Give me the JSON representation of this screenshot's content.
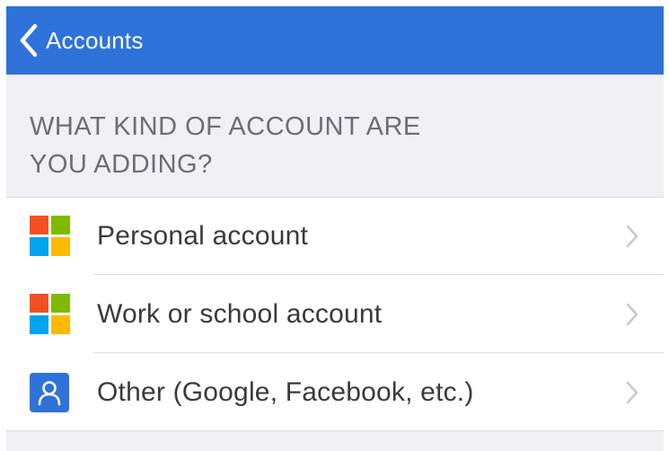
{
  "nav": {
    "back_label": "Accounts",
    "back_icon": "chevron-left-icon",
    "bar_color": "#2f72d9"
  },
  "section_header": {
    "line1": "WHAT KIND OF ACCOUNT ARE",
    "line2": "YOU ADDING?"
  },
  "options": [
    {
      "label": "Personal account",
      "icon": "microsoft-logo-icon"
    },
    {
      "label": "Work or school account",
      "icon": "microsoft-logo-icon"
    },
    {
      "label": "Other (Google, Facebook, etc.)",
      "icon": "person-icon"
    }
  ],
  "colors": {
    "ms_red": "#f25022",
    "ms_green": "#7fba00",
    "ms_blue": "#00a4ef",
    "ms_yellow": "#ffb900",
    "person_tile": "#2f72d9",
    "section_bg": "#efeff4"
  }
}
